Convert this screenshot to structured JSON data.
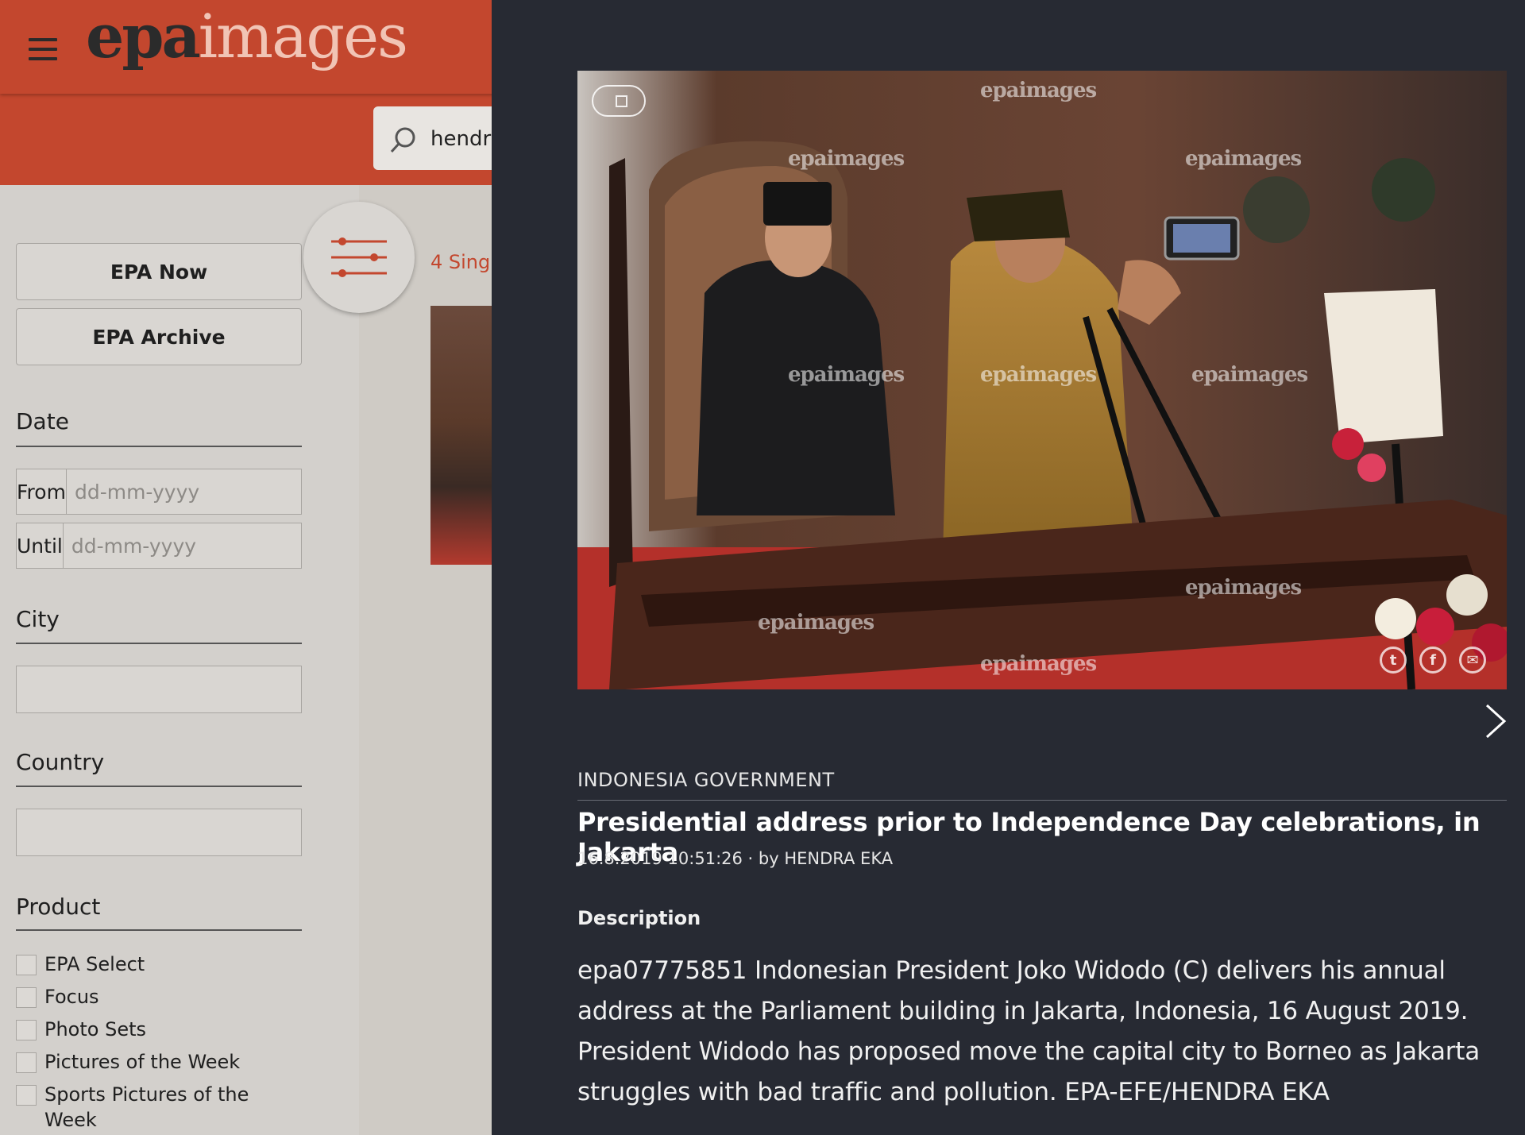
{
  "header": {
    "logo_part1": "epa",
    "logo_part2": "images"
  },
  "search": {
    "value": "hendra"
  },
  "sidebar": {
    "buttons": [
      "EPA Now",
      "EPA Archive"
    ],
    "date_label": "Date",
    "from_label": "From",
    "until_label": "Until",
    "date_placeholder": "dd-mm-yyyy",
    "city_label": "City",
    "country_label": "Country",
    "product_label": "Product",
    "products": [
      "EPA Select",
      "Focus",
      "Photo Sets",
      "Pictures of the Week",
      "Sports Pictures of the Week"
    ]
  },
  "results": {
    "count_text": "4 Sing"
  },
  "detail": {
    "watermark": "epaimages",
    "category": "INDONESIA GOVERNMENT",
    "headline": "Presidential address prior to Independence Day celebrations, in Jakarta",
    "meta": "16.8.2019 10:51:26 · by HENDRA EKA",
    "description_heading": "Description",
    "description": "epa07775851 Indonesian President Joko Widodo (C) delivers his annual address at the Parliament building in Jakarta, Indonesia, 16 August 2019. President Widodo has proposed move the capital city to Borneo as Jakarta struggles with bad traffic and pollution. EPA-EFE/HENDRA EKA",
    "social_icons": [
      "twitter-icon",
      "facebook-icon",
      "email-icon"
    ]
  },
  "colors": {
    "brand_red": "#c3472e",
    "panel_bg": "#272a33"
  }
}
